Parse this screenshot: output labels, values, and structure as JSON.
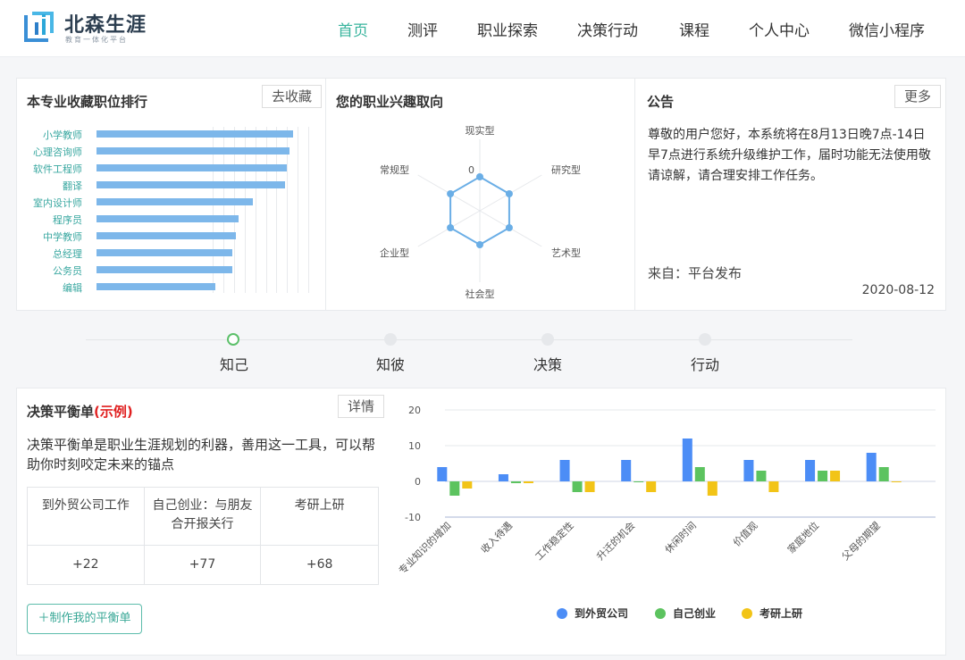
{
  "header": {
    "logo_name": "北森生涯",
    "logo_tagline": "教育一体化平台",
    "nav": [
      "首页",
      "测评",
      "职业探索",
      "决策行动",
      "课程",
      "个人中心",
      "微信小程序"
    ],
    "active_index": 0,
    "accent_color": "#38b49d"
  },
  "ranking": {
    "title": "本专业收藏职位排行",
    "button": "去收藏",
    "chart_data": {
      "type": "bar",
      "orientation": "horizontal",
      "categories": [
        "小学教师",
        "心理咨询师",
        "软件工程师",
        "翻译",
        "室内设计师",
        "程序员",
        "中学教师",
        "总经理",
        "公务员",
        "编辑"
      ],
      "values": [
        93,
        91,
        90,
        89,
        74,
        67,
        66,
        64,
        64,
        56
      ],
      "xlim": [
        0,
        100
      ],
      "grid": true,
      "color": "#7db7ea"
    }
  },
  "interest": {
    "title": "您的职业兴趣取向",
    "chart_data": {
      "type": "radar",
      "axes": [
        "现实型",
        "研究型",
        "艺术型",
        "社会型",
        "企业型",
        "常规型"
      ],
      "values": [
        0,
        0,
        0,
        0,
        0,
        0
      ],
      "center_label": "0",
      "color": "#6aaee6"
    }
  },
  "notice": {
    "title": "公告",
    "button": "更多",
    "text": "尊敬的用户您好，本系统将在8月13日晚7点-14日早7点进行系统升级维护工作，届时功能无法使用敬请谅解，请合理安排工作任务。",
    "from": "来自：平台发布",
    "date": "2020-08-12"
  },
  "steps": {
    "items": [
      "知己",
      "知彼",
      "决策",
      "行动"
    ],
    "active_index": 0
  },
  "balance": {
    "title": "决策平衡单",
    "title_tag": "(示例)",
    "button": "详情",
    "desc": "决策平衡单是职业生涯规划的利器，善用这一工具，可以帮助你时刻咬定未来的锚点",
    "columns": [
      "到外贸公司工作",
      "自己创业：与朋友合开报关行",
      "考研上研"
    ],
    "scores": [
      "+22",
      "+77",
      "+68"
    ],
    "make_button": "＋制作我的平衡单"
  },
  "balance_chart": {
    "chart_data": {
      "type": "bar",
      "categories": [
        "专业知识的增加",
        "收入待遇",
        "工作稳定性",
        "升迁的机会",
        "休闲时间",
        "价值观",
        "家庭地位",
        "父母的期望"
      ],
      "series": [
        {
          "name": "到外贸公司",
          "color": "#4c8df6",
          "values": [
            4,
            2,
            6,
            6,
            12,
            6,
            6,
            8
          ]
        },
        {
          "name": "自己创业",
          "color": "#5cc35f",
          "values": [
            -4,
            -0.5,
            -3,
            0,
            4,
            3,
            3,
            4
          ]
        },
        {
          "name": "考研上研",
          "color": "#f2c417",
          "values": [
            -2,
            -0.5,
            -3,
            -3,
            -4,
            -3,
            3,
            0
          ]
        }
      ],
      "yticks": [
        "20",
        "10",
        "0",
        "-10"
      ],
      "ylim": [
        -10,
        20
      ],
      "grid": true,
      "legend": "bottom"
    }
  }
}
